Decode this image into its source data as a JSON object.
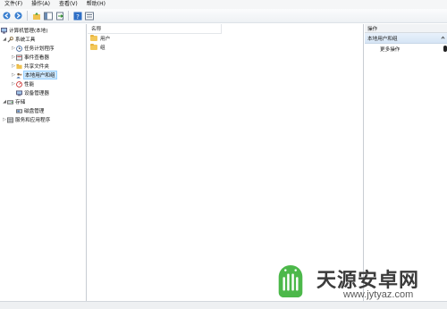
{
  "menubar": {
    "items": [
      "文件(F)",
      "操作(A)",
      "查看(V)",
      "帮助(H)"
    ]
  },
  "toolbar": {
    "buttons": [
      "back-icon",
      "forward-icon",
      "up-folder-icon",
      "show-hide-tree-icon",
      "export-icon",
      "help-icon",
      "view-icon"
    ]
  },
  "tree": {
    "root": "计算机管理(本地)",
    "system_tools": "系统工具",
    "task_scheduler": "任务计划程序",
    "event_viewer": "事件查看器",
    "shared_folders": "共享文件夹",
    "local_users": "本地用户和组",
    "performance": "性能",
    "device_manager": "设备管理器",
    "storage": "存储",
    "disk_management": "磁盘管理",
    "services": "服务和应用程序"
  },
  "list": {
    "column_name": "名称",
    "items": [
      "用户",
      "组"
    ]
  },
  "actions": {
    "header": "操作",
    "group": "本地用户和组",
    "more": "更多操作"
  },
  "watermark": {
    "title": "天源安卓网",
    "url": "www.jytyaz.com"
  },
  "colors": {
    "selection": "#cde8ff",
    "folder": "#f3c85a",
    "watermark_green": "#4cb84a"
  }
}
